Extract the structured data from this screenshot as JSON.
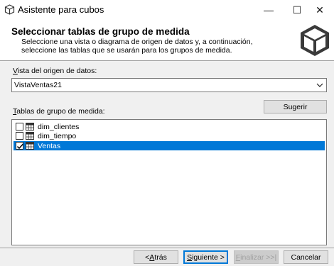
{
  "window": {
    "title": "Asistente para cubos",
    "min_symbol": "—",
    "max_symbol": "☐",
    "close_symbol": "✕"
  },
  "header": {
    "title": "Seleccionar tablas de grupo de medida",
    "description": "Seleccione una vista o diagrama de origen de datos y, a continuación, seleccione las tablas que se usarán para los grupos de medida."
  },
  "datasource": {
    "label_prefix": "",
    "label_hotkey": "V",
    "label_rest": "ista del origen de datos:",
    "selected": "VistaVentas21"
  },
  "tables": {
    "label_hotkey": "T",
    "label_rest": "ablas de grupo de medida:",
    "suggest_pre": "Su",
    "suggest_hotkey": "g",
    "suggest_post": "erir",
    "items": [
      {
        "name": "dim_clientes",
        "checked": false,
        "selected": false
      },
      {
        "name": "dim_tiempo",
        "checked": false,
        "selected": false
      },
      {
        "name": "Ventas",
        "checked": true,
        "selected": true
      }
    ]
  },
  "footer": {
    "back_pre": "< ",
    "back_hotkey": "A",
    "back_post": "trás",
    "next_pre": "",
    "next_hotkey": "S",
    "next_post": "iguiente >",
    "finish_pre": "",
    "finish_hotkey": "F",
    "finish_post": "inalizar >>|",
    "cancel": "Cancelar"
  },
  "colors": {
    "selection": "#0078d7",
    "dialog_bg": "#f0f0f0"
  }
}
